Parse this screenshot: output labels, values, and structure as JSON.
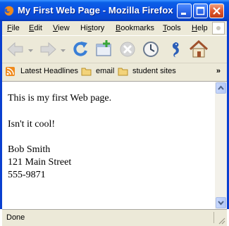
{
  "window": {
    "title": "My First Web Page - Mozilla Firefox",
    "buttons": {
      "minimize": "minimize-icon",
      "maximize": "maximize-icon",
      "close": "close-icon"
    }
  },
  "menu": [
    "File",
    "Edit",
    "View",
    "History",
    "Bookmarks",
    "Tools",
    "Help"
  ],
  "menu_access_keys": [
    "F",
    "E",
    "V",
    "S",
    "B",
    "T",
    "H"
  ],
  "navigation": {
    "icons": [
      "back-icon",
      "forward-icon",
      "reload-icon",
      "new-tab-icon",
      "stop-icon",
      "history-icon",
      "seahorse-icon",
      "home-icon"
    ]
  },
  "bookmarks": {
    "items": [
      {
        "label": "Latest Headlines",
        "icon": "rss-icon"
      },
      {
        "label": "email",
        "icon": "folder-icon"
      },
      {
        "label": "student sites",
        "icon": "folder-icon"
      }
    ],
    "overflow": "»"
  },
  "page": {
    "line1": "This is my first Web page.",
    "line2": "Isn't it cool!",
    "name": "Bob Smith",
    "street": "121 Main Street",
    "phone": "555-9871"
  },
  "status": {
    "text": "Done"
  },
  "colors": {
    "titlebar": "#0a4ee0",
    "chrome": "#ece9d8",
    "close": "#e0582f"
  }
}
